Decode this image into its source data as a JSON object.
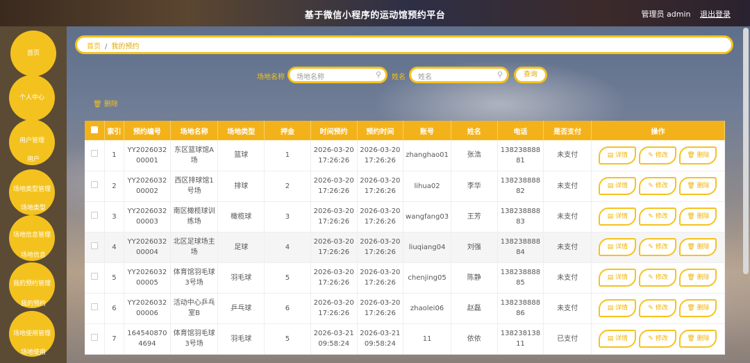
{
  "header": {
    "title": "基于微信小程序的运动馆预约平台",
    "user_label": "管理员 admin",
    "logout": "退出登录"
  },
  "sidebar": {
    "items": [
      {
        "label": "首页"
      },
      {
        "label": "个人中心"
      },
      {
        "label": "用户管理",
        "sub": "用户"
      },
      {
        "label": "场地类型管理",
        "sub": "场地类型"
      },
      {
        "label": "场地信息管理",
        "sub": "场地信息"
      },
      {
        "label": "我的预约管理",
        "sub": "我的预约"
      },
      {
        "label": "场地使用管理",
        "sub": "场地使用"
      }
    ]
  },
  "breadcrumb": {
    "home": "首页",
    "current": "我的预约"
  },
  "search": {
    "venue_label": "场地名称",
    "venue_placeholder": "场地名称",
    "name_label": "姓名",
    "name_placeholder": "姓名",
    "button": "查询"
  },
  "toolbar": {
    "delete": "删除"
  },
  "table": {
    "columns": [
      "索引",
      "预约编号",
      "场地名称",
      "场地类型",
      "押金",
      "时间预约",
      "预约时间",
      "账号",
      "姓名",
      "电话",
      "是否支付",
      "操作"
    ],
    "actions": {
      "detail": "详情",
      "edit": "修改",
      "delete": "删除"
    },
    "rows": [
      [
        "1",
        "YY202603200001",
        "东区篮球馆A场",
        "篮球",
        "1",
        "2026-03-20 17:26:26",
        "2026-03-20 17:26:26",
        "zhanghao01",
        "张浩",
        "13823888881",
        "未支付"
      ],
      [
        "2",
        "YY202603200002",
        "西区排球馆1号场",
        "排球",
        "2",
        "2026-03-20 17:26:26",
        "2026-03-20 17:26:26",
        "lihua02",
        "李华",
        "13823888882",
        "未支付"
      ],
      [
        "3",
        "YY202603200003",
        "南区橄榄球训练场",
        "橄榄球",
        "3",
        "2026-03-20 17:26:26",
        "2026-03-20 17:26:26",
        "wangfang03",
        "王芳",
        "13823888883",
        "未支付"
      ],
      [
        "4",
        "YY202603200004",
        "北区足球场主场",
        "足球",
        "4",
        "2026-03-20 17:26:26",
        "2026-03-20 17:26:26",
        "liuqiang04",
        "刘强",
        "13823888884",
        "未支付"
      ],
      [
        "5",
        "YY202603200005",
        "体育馆羽毛球3号场",
        "羽毛球",
        "5",
        "2026-03-20 17:26:26",
        "2026-03-20 17:26:26",
        "chenjing05",
        "陈静",
        "13823888885",
        "未支付"
      ],
      [
        "6",
        "YY202603200006",
        "活动中心乒乓室B",
        "乒乓球",
        "6",
        "2026-03-20 17:26:26",
        "2026-03-20 17:26:26",
        "zhaolei06",
        "赵磊",
        "13823888886",
        "未支付"
      ],
      [
        "7",
        "1645408704694",
        "体育馆羽毛球3号场",
        "羽毛球",
        "5",
        "2026-03-21 09:58:24",
        "2026-03-21 09:58:24",
        "11",
        "依依",
        "13823813811",
        "已支付"
      ]
    ]
  }
}
